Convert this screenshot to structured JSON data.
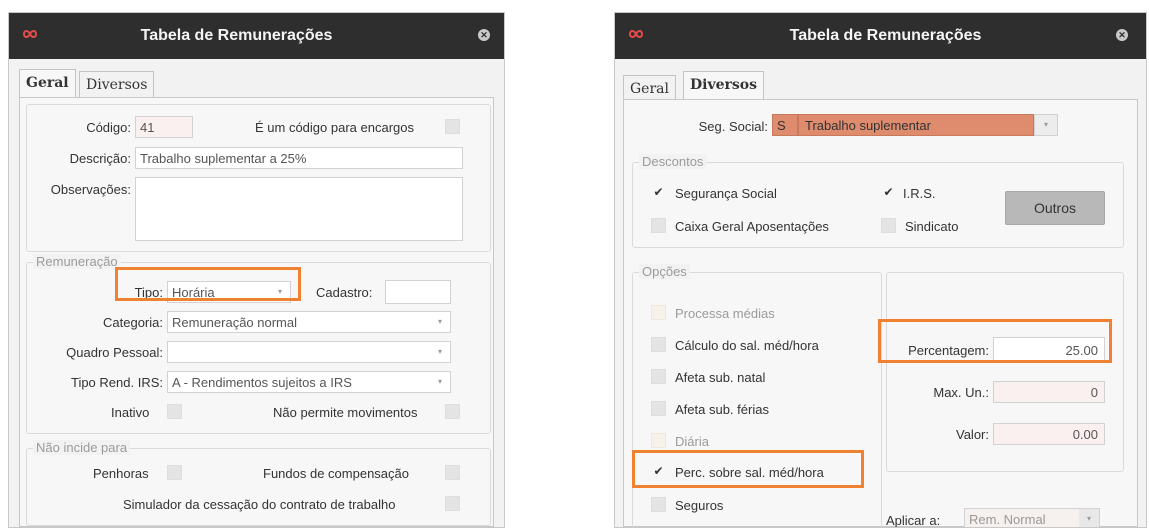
{
  "colors": {
    "titlebar": "#2e2e2e",
    "highlight": "#f08130",
    "seg_social_bg": "#de8b6e",
    "logo": "#e54b4b"
  },
  "icons": {
    "logo": "infinity-logo-icon",
    "close": "close-icon",
    "dropdown": "chevron-down-icon",
    "check": "checkmark-icon"
  },
  "geral": {
    "title": "Tabela de Remunerações",
    "tabs": [
      {
        "label": "Geral",
        "active": true
      },
      {
        "label": "Diversos",
        "active": false
      }
    ],
    "codigo": {
      "label": "Código:",
      "value": "41"
    },
    "encargos": {
      "label": "É um código para encargos",
      "checked": false
    },
    "descricao": {
      "label": "Descrição:",
      "value": "Trabalho suplementar a 25%"
    },
    "observacoes": {
      "label": "Observações:",
      "value": ""
    },
    "remuneracao": {
      "title": "Remuneração",
      "tipo": {
        "label": "Tipo:",
        "value": "Horária"
      },
      "cadastro": {
        "label": "Cadastro:",
        "value": ""
      },
      "categoria": {
        "label": "Categoria:",
        "value": "Remuneração normal"
      },
      "quadro": {
        "label": "Quadro Pessoal:",
        "value": ""
      },
      "tipo_rend": {
        "label": "Tipo Rend. IRS:",
        "value": "A - Rendimentos sujeitos a IRS"
      },
      "inativo": {
        "label": "Inativo",
        "checked": false
      },
      "nao_permite": {
        "label": "Não permite movimentos",
        "checked": false
      }
    },
    "nao_incide": {
      "title": "Não incide para",
      "penhoras": {
        "label": "Penhoras",
        "checked": false
      },
      "fundos": {
        "label": "Fundos de compensação",
        "checked": false
      },
      "simulador": {
        "label": "Simulador da cessação do contrato de trabalho",
        "checked": false
      }
    }
  },
  "diversos": {
    "title": "Tabela de Remunerações",
    "tabs": [
      {
        "label": "Geral",
        "active": false
      },
      {
        "label": "Diversos",
        "active": true
      }
    ],
    "seg_social": {
      "label": "Seg. Social:",
      "code": "S",
      "value": "Trabalho suplementar"
    },
    "descontos": {
      "title": "Descontos",
      "seguranca": {
        "label": "Segurança Social",
        "checked": true
      },
      "irs": {
        "label": "I.R.S.",
        "checked": true
      },
      "caixa": {
        "label": "Caixa Geral Aposentações",
        "checked": false
      },
      "sindicato": {
        "label": "Sindicato",
        "checked": false
      },
      "outros": "Outros"
    },
    "opcoes": {
      "title": "Opções",
      "items": [
        {
          "label": "Processa médias",
          "checked": false,
          "enabled": false
        },
        {
          "label": "Cálculo do sal. méd/hora",
          "checked": false,
          "enabled": true
        },
        {
          "label": "Afeta sub. natal",
          "checked": false,
          "enabled": true
        },
        {
          "label": "Afeta sub. férias",
          "checked": false,
          "enabled": true
        },
        {
          "label": "Diária",
          "checked": false,
          "enabled": false
        },
        {
          "label": "Perc. sobre sal. méd/hora",
          "checked": true,
          "enabled": true
        },
        {
          "label": "Seguros",
          "checked": false,
          "enabled": true
        }
      ]
    },
    "percentagem": {
      "label": "Percentagem:",
      "value": "25.00"
    },
    "max_un": {
      "label": "Max. Un.:",
      "value": "0"
    },
    "valor": {
      "label": "Valor:",
      "value": "0.00"
    },
    "aplicar": {
      "label": "Aplicar a:",
      "value": "Rem. Normal"
    }
  }
}
